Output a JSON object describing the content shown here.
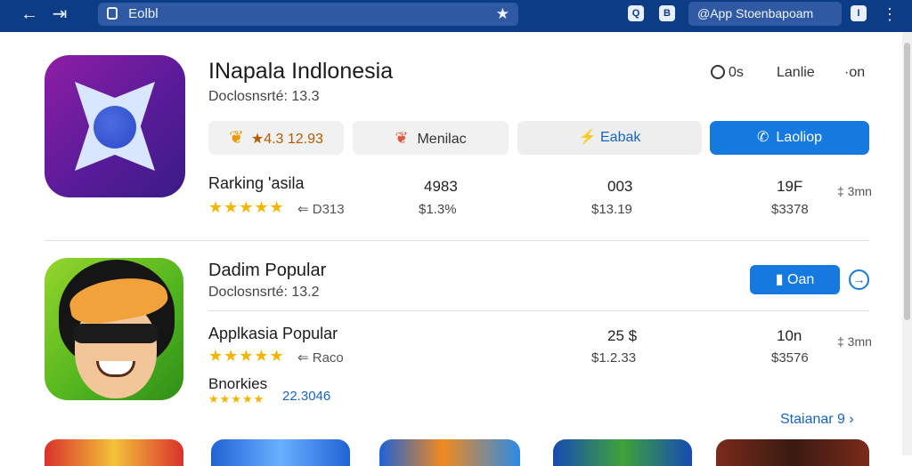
{
  "topbar": {
    "back_icon": "←",
    "forward_icon": "⇥",
    "url": "Eolbl",
    "star": "★",
    "icon_a": "Q",
    "icon_b": "B",
    "search_placeholder": "@App Stoenbapoam",
    "icon_c": "I",
    "menu": "⋮"
  },
  "app1": {
    "title": "INapala Indlonesia",
    "developer": "Doclosnsrté: 13.3",
    "meta": {
      "a": "0s",
      "b": "Lanlie",
      "c": "·on"
    },
    "buttons": {
      "rating": "★4.3 12.93",
      "mentor": "Menilac",
      "favorite": "⚡ Eabak",
      "install": "Laoliop"
    },
    "stats": {
      "label": "Rarking 'asila",
      "stars": "★★★★★",
      "stars_sub": "⇐ D313",
      "cols": [
        {
          "top": "4983",
          "bottom": "$1.3%"
        },
        {
          "top": "003",
          "bottom": "$13.19"
        },
        {
          "top": "19F",
          "bottom": "$3378"
        }
      ],
      "side": "‡ 3mn"
    }
  },
  "app2": {
    "title": "Dadim Popular",
    "developer": "Doclosnsrté: 13.2",
    "open": "▮ Oan",
    "next": "→",
    "stats": {
      "label": "Applkasia Popular",
      "stars": "★★★★★",
      "stars_sub": "⇐ Raco",
      "cols": [
        {
          "top": "25 $",
          "bottom": "$1.2.33"
        },
        {
          "top": "10n",
          "bottom": "$3576"
        }
      ],
      "side": "‡ 3mn"
    },
    "extra": {
      "label": "Bnorkies",
      "stars": "★★★★★",
      "value": "22.3046"
    }
  },
  "see_all": "Staianar 9 ›"
}
